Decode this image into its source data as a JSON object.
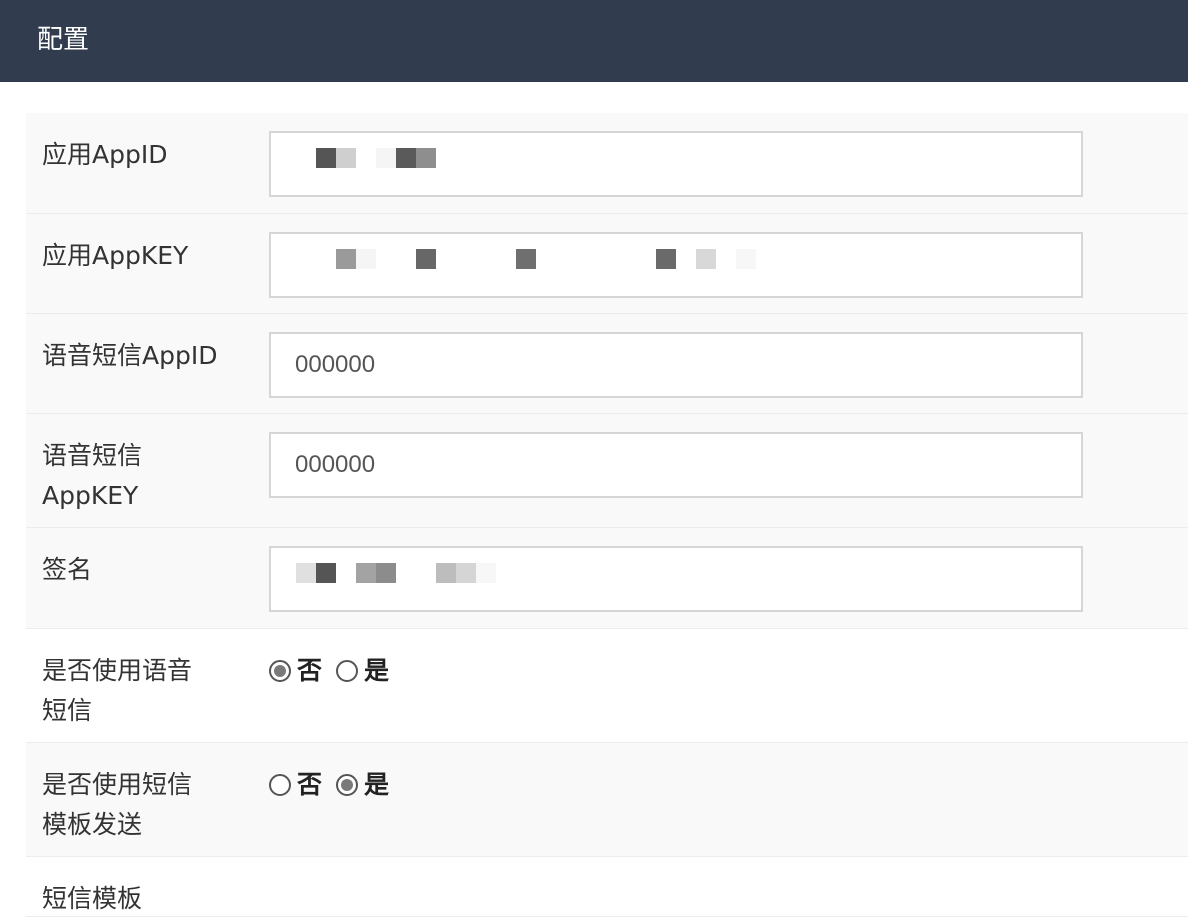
{
  "header": {
    "title": "配置"
  },
  "fields": {
    "appid": {
      "label": "应用AppID"
    },
    "appkey": {
      "label": "应用AppKEY"
    },
    "voice_appid": {
      "label": "语音短信AppID",
      "value": "000000"
    },
    "voice_appkey": {
      "label": "语音短信AppKEY",
      "value": "000000"
    },
    "signature": {
      "label": "签名"
    },
    "use_voice": {
      "label": "是否使用语音短信",
      "options": [
        "否",
        "是"
      ],
      "selected": "否"
    },
    "use_template": {
      "label": "是否使用短信模板发送",
      "options": [
        "否",
        "是"
      ],
      "selected": "是"
    },
    "sms_template": {
      "label": "短信模板"
    }
  }
}
